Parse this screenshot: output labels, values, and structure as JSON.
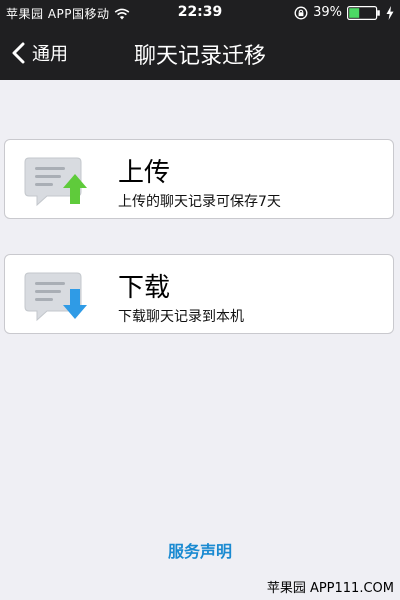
{
  "status_bar": {
    "carrier": "苹果园 APP国移动",
    "time": "22:39",
    "battery_percent": "39%",
    "battery_level": 0.39,
    "icons": [
      "wifi-icon",
      "orientation-lock-icon",
      "battery-icon",
      "charging-bolt-icon"
    ]
  },
  "nav": {
    "back_label": "通用",
    "title": "聊天记录迁移"
  },
  "cards": [
    {
      "id": "upload",
      "title": "上传",
      "subtitle": "上传的聊天记录可保存7天",
      "icon": "chat-upload-icon",
      "arrow_color": "#5fcb3b"
    },
    {
      "id": "download",
      "title": "下载",
      "subtitle": "下载聊天记录到本机",
      "icon": "chat-download-icon",
      "arrow_color": "#2f9be6"
    }
  ],
  "footer": {
    "service_link": "服务声明",
    "watermark": "苹果园 APP111.COM"
  },
  "colors": {
    "nav_background": "#1f1f21",
    "page_background": "#efeff4",
    "link": "#1a8ad1"
  }
}
